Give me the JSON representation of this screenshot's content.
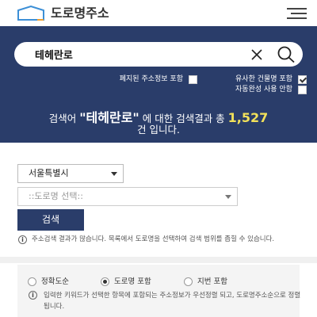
{
  "header": {
    "logo_text": "도로명주소",
    "logo_icon": "house-outline-icon",
    "menu_icon": "hamburger-menu-icon"
  },
  "search": {
    "value": "테헤란로",
    "clear_icon": "close-icon",
    "search_icon": "magnifier-icon"
  },
  "options": [
    {
      "label": "폐지된 주소정보 포함",
      "checked": false
    },
    {
      "label": "유사한 건물명 포함",
      "checked": true
    },
    {
      "label": "자동완성 사용 안함",
      "checked": false
    }
  ],
  "result": {
    "prefix": "검색어",
    "keyword": "\"테헤란로\"",
    "middle": "에 대한 검색결과 총",
    "count": "1,527",
    "suffix": "건 입니다."
  },
  "filters": {
    "region_selected": "서울특별시",
    "road_placeholder": "::도로명 선택::",
    "search_button": "검색"
  },
  "notice_filter": "주소검색 결과가 많습니다. 목록에서 도로명을 선택하여 검색 범위를 좁힐 수 있습니다.",
  "sort": {
    "options": [
      {
        "label": "정확도순",
        "selected": false
      },
      {
        "label": "도로명 포함",
        "selected": true
      },
      {
        "label": "지번 포함",
        "selected": false
      }
    ],
    "notice": "입력한 키워드가 선택한 항목에 포함되는 주소정보가 우선정렬 되고, 도로명주소순으로 정렬됩니다."
  },
  "colors": {
    "hero_bg": "#2a3d6a",
    "count_highlight": "#f2e15a"
  }
}
